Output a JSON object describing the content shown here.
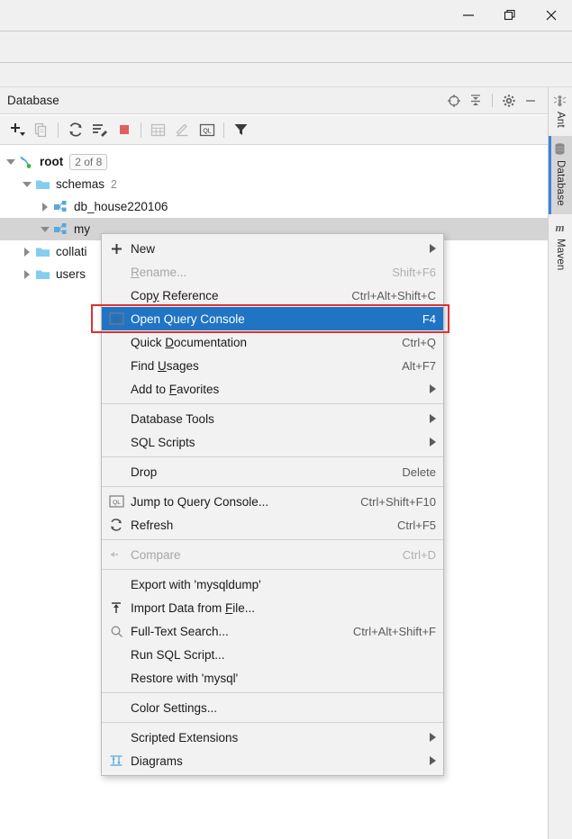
{
  "window": {
    "controls": [
      {
        "name": "minimize",
        "glyph": "minimize-icon"
      },
      {
        "name": "restore",
        "glyph": "restore-icon"
      },
      {
        "name": "close",
        "glyph": "close-icon"
      }
    ]
  },
  "panel": {
    "title": "Database",
    "header_actions": [
      {
        "name": "locate-icon",
        "label": "Select Opened File"
      },
      {
        "name": "collapse-all-icon",
        "label": "Collapse All"
      },
      {
        "name": "gear-icon",
        "label": "Settings"
      },
      {
        "name": "hide-icon",
        "label": "Hide"
      }
    ],
    "toolbar": [
      {
        "name": "add-icon",
        "label": "New"
      },
      {
        "name": "duplicate-icon",
        "label": "Duplicate",
        "disabled": true
      },
      {
        "name": "refresh-icon",
        "label": "Refresh"
      },
      {
        "name": "sync-settings-icon",
        "label": "Data Source Properties"
      },
      {
        "name": "stop-icon",
        "label": "Stop"
      },
      {
        "name": "table-icon",
        "label": "Open Table Editor",
        "disabled": true
      },
      {
        "name": "edit-icon",
        "label": "Modify",
        "disabled": true
      },
      {
        "name": "query-console-icon",
        "label": "Open Query Console"
      },
      {
        "name": "filter-icon",
        "label": "Filter"
      }
    ]
  },
  "tree": {
    "rows": [
      {
        "indent": 0,
        "twisty": "down",
        "icon": "mysql-datasource-icon",
        "label": "root",
        "bold": true,
        "badge": "2 of 8",
        "selected": false
      },
      {
        "indent": 1,
        "twisty": "down",
        "icon": "folder-icon",
        "label": "schemas",
        "count": "2",
        "selected": false
      },
      {
        "indent": 2,
        "twisty": "right",
        "icon": "schema-icon",
        "label": "db_house220106",
        "selected": false
      },
      {
        "indent": 2,
        "twisty": "down",
        "icon": "schema-icon",
        "label": "my",
        "selected": true
      },
      {
        "indent": 1,
        "twisty": "right",
        "icon": "folder-icon",
        "label": "collati",
        "selected": false
      },
      {
        "indent": 1,
        "twisty": "right",
        "icon": "folder-icon",
        "label": "users",
        "selected": false
      }
    ]
  },
  "context_menu": {
    "groups": [
      {
        "items": [
          {
            "icon": "plus-icon",
            "label": "New",
            "shortcut": "",
            "submenu": true,
            "disabled": false,
            "highlight": false
          },
          {
            "icon": "",
            "label": "Rename...",
            "shortcut": "Shift+F6",
            "submenu": false,
            "disabled": true,
            "highlight": false
          },
          {
            "icon": "",
            "label": "Copy Reference",
            "shortcut": "Ctrl+Alt+Shift+C",
            "submenu": false,
            "disabled": false,
            "highlight": false
          },
          {
            "icon": "query-console-icon",
            "label": "Open Query Console",
            "shortcut": "F4",
            "submenu": false,
            "disabled": false,
            "highlight": true
          },
          {
            "icon": "",
            "label": "Quick Documentation",
            "shortcut": "Ctrl+Q",
            "submenu": false,
            "disabled": false,
            "highlight": false
          },
          {
            "icon": "",
            "label": "Find Usages",
            "shortcut": "Alt+F7",
            "submenu": false,
            "disabled": false,
            "highlight": false
          },
          {
            "icon": "",
            "label": "Add to Favorites",
            "shortcut": "",
            "submenu": true,
            "disabled": false,
            "highlight": false
          }
        ]
      },
      {
        "items": [
          {
            "icon": "",
            "label": "Database Tools",
            "shortcut": "",
            "submenu": true,
            "disabled": false,
            "highlight": false
          },
          {
            "icon": "",
            "label": "SQL Scripts",
            "shortcut": "",
            "submenu": true,
            "disabled": false,
            "highlight": false
          }
        ]
      },
      {
        "items": [
          {
            "icon": "",
            "label": "Drop",
            "shortcut": "Delete",
            "submenu": false,
            "disabled": false,
            "highlight": false
          }
        ]
      },
      {
        "items": [
          {
            "icon": "query-console-icon",
            "label": "Jump to Query Console...",
            "shortcut": "Ctrl+Shift+F10",
            "submenu": false,
            "disabled": false,
            "highlight": false
          },
          {
            "icon": "refresh-icon",
            "label": "Refresh",
            "shortcut": "Ctrl+F5",
            "submenu": false,
            "disabled": false,
            "highlight": false
          }
        ]
      },
      {
        "items": [
          {
            "icon": "compare-icon",
            "label": "Compare",
            "shortcut": "Ctrl+D",
            "submenu": false,
            "disabled": true,
            "highlight": false
          }
        ]
      },
      {
        "items": [
          {
            "icon": "",
            "label": "Export with 'mysqldump'",
            "shortcut": "",
            "submenu": false,
            "disabled": false,
            "highlight": false
          },
          {
            "icon": "import-icon",
            "label": "Import Data from File...",
            "shortcut": "",
            "submenu": false,
            "disabled": false,
            "highlight": false
          },
          {
            "icon": "search-icon",
            "label": "Full-Text Search...",
            "shortcut": "Ctrl+Alt+Shift+F",
            "submenu": false,
            "disabled": false,
            "highlight": false
          },
          {
            "icon": "",
            "label": "Run SQL Script...",
            "shortcut": "",
            "submenu": false,
            "disabled": false,
            "highlight": false
          },
          {
            "icon": "",
            "label": "Restore with 'mysql'",
            "shortcut": "",
            "submenu": false,
            "disabled": false,
            "highlight": false
          }
        ]
      },
      {
        "items": [
          {
            "icon": "",
            "label": "Color Settings...",
            "shortcut": "",
            "submenu": false,
            "disabled": false,
            "highlight": false
          }
        ]
      },
      {
        "items": [
          {
            "icon": "",
            "label": "Scripted Extensions",
            "shortcut": "",
            "submenu": true,
            "disabled": false,
            "highlight": false
          },
          {
            "icon": "diagram-icon",
            "label": "Diagrams",
            "shortcut": "",
            "submenu": true,
            "disabled": false,
            "highlight": false
          }
        ]
      }
    ]
  },
  "right_tabs": [
    {
      "label": "Ant",
      "icon": "ant-icon",
      "active": false
    },
    {
      "label": "Database",
      "icon": "database-icon",
      "active": true
    },
    {
      "label": "Maven",
      "icon": "maven-icon",
      "active": false
    }
  ],
  "colors": {
    "menu_highlight": "#1f74c4",
    "annotation": "#e03030",
    "accent_tab": "#3b84d8",
    "icon_blue": "#56a8de",
    "stop_red": "#e06060",
    "status_green": "#3fb63f"
  }
}
